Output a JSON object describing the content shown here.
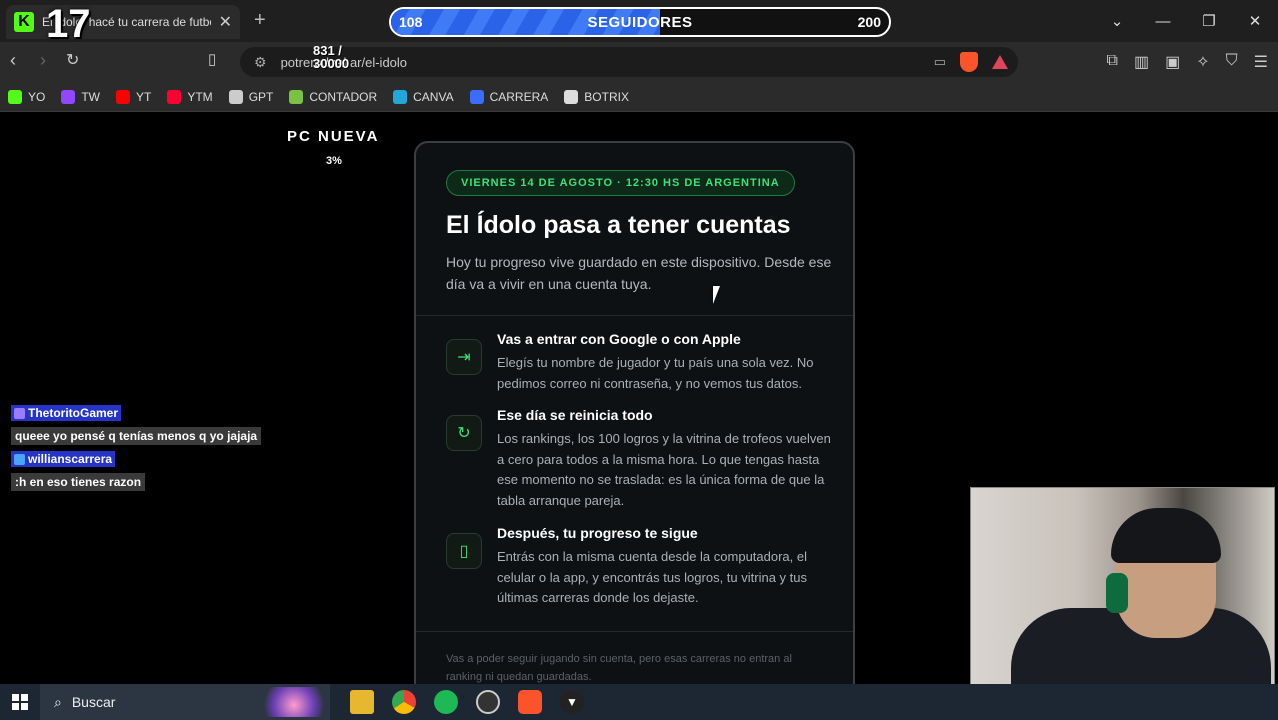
{
  "browser": {
    "tab_title": "El Ídolo: hacé tu carrera de futbol",
    "tab_favicon": "K",
    "url": "potrerodual.ar/el-idolo"
  },
  "overlay": {
    "counter": "17",
    "goal_current": "108",
    "goal_label": "SEGUIDORES",
    "goal_target": "200",
    "goal_progress": 0.54,
    "small_stats": "831 /",
    "small_stats_2": "30000",
    "pc_title": "PC NUEVA",
    "pc_percent": "3%"
  },
  "bookmarks": [
    {
      "label": "YO",
      "color": "#53fc18"
    },
    {
      "label": "TW",
      "color": "#9146ff"
    },
    {
      "label": "YT",
      "color": "#ff0000"
    },
    {
      "label": "YTM",
      "color": "#ff0033"
    },
    {
      "label": "GPT",
      "color": "#cccccc"
    },
    {
      "label": "CONTADOR",
      "color": "#7cc242"
    },
    {
      "label": "CANVA",
      "color": "#21a8d8"
    },
    {
      "label": "CARRERA",
      "color": "#3a6cff"
    },
    {
      "label": "BOTRIX",
      "color": "#dddddd"
    }
  ],
  "card": {
    "date": "VIERNES 14 DE AGOSTO · 12:30 HS DE ARGENTINA",
    "title": "El Ídolo pasa a tener cuentas",
    "subtitle": "Hoy tu progreso vive guardado en este dispositivo. Desde ese día va a vivir en una cuenta tuya.",
    "items": [
      {
        "icon": "login-icon",
        "title": "Vas a entrar con Google o con Apple",
        "body": "Elegís tu nombre de jugador y tu país una sola vez. No pedimos correo ni contraseña, y no vemos tus datos."
      },
      {
        "icon": "reset-icon",
        "title": "Ese día se reinicia todo",
        "body": "Los rankings, los 100 logros y la vitrina de trofeos vuelven a cero para todos a la misma hora. Lo que tengas hasta ese momento no se traslada: es la única forma de que la tabla arranque pareja."
      },
      {
        "icon": "phone-icon",
        "title": "Después, tu progreso te sigue",
        "body": "Entrás con la misma cuenta desde la computadora, el celular o la app, y encontrás tus logros, tu vitrina y tus últimas carreras donde los dejaste."
      }
    ],
    "footnote": "Vas a poder seguir jugando sin cuenta, pero esas carreras no entran al ranking ni quedan guardadas."
  },
  "chat": [
    {
      "user": "ThetoritoGamer",
      "message": "queee yo pensé q tenías menos q yo jajaja"
    },
    {
      "user": "willianscarrera",
      "message": ":h en eso tienes razon"
    }
  ],
  "taskbar": {
    "search_label": "Buscar"
  }
}
